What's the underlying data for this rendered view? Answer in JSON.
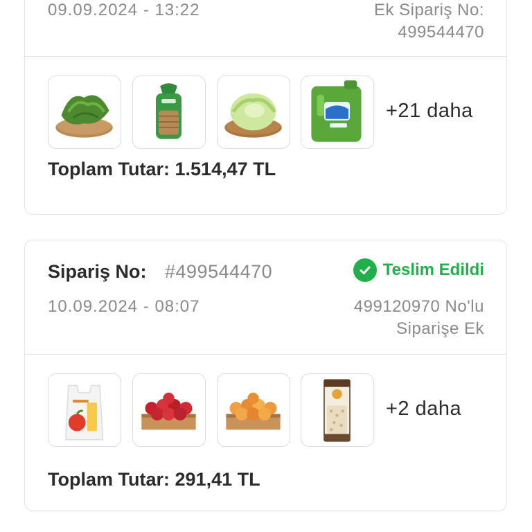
{
  "orders": [
    {
      "date": "09.09.2024 - 13:22",
      "note_line1": "Ek Sipariş No:",
      "note_line2": "499544470",
      "products": [
        {
          "icon": "spinach-icon"
        },
        {
          "icon": "bread-bag-icon"
        },
        {
          "icon": "lettuce-icon"
        },
        {
          "icon": "detergent-bottle-icon"
        }
      ],
      "more": "+21 daha",
      "total_label": "Toplam Tutar:",
      "total_value": "1.514,47 TL"
    },
    {
      "order_label": "Sipariş No:",
      "order_number": "#499544470",
      "status": "Teslim Edildi",
      "status_color": "#1fb04a",
      "date": "10.09.2024 - 08:07",
      "note_line1": "499120970 No'lu",
      "note_line2": "Siparişe Ek",
      "products": [
        {
          "icon": "shopping-bag-icon"
        },
        {
          "icon": "apples-crate-icon"
        },
        {
          "icon": "peaches-crate-icon"
        },
        {
          "icon": "oats-package-icon"
        }
      ],
      "more": "+2 daha",
      "total_label": "Toplam Tutar:",
      "total_value": "291,41 TL"
    }
  ]
}
